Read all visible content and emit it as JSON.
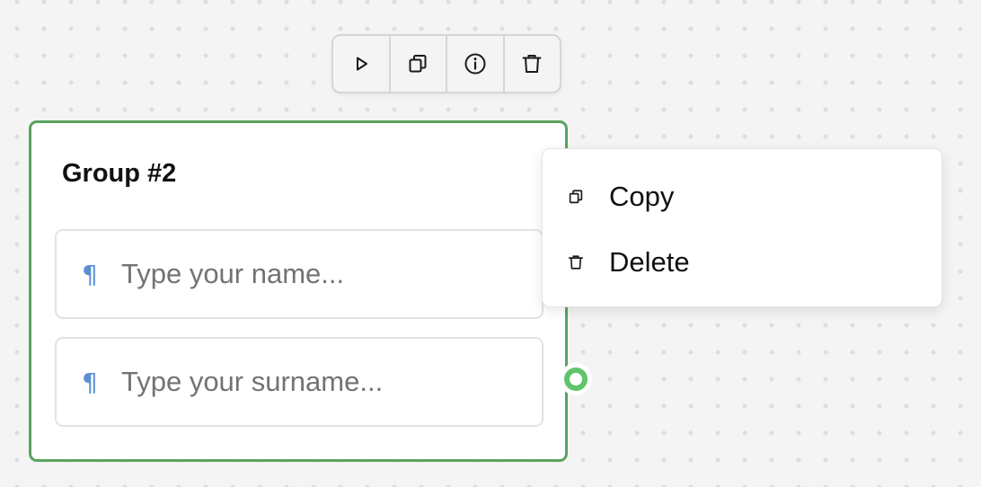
{
  "toolbar": {
    "buttons": [
      {
        "icon": "play-icon",
        "name": "run-button"
      },
      {
        "icon": "copy-icon",
        "name": "duplicate-button"
      },
      {
        "icon": "info-icon",
        "name": "info-button"
      },
      {
        "icon": "trash-icon",
        "name": "delete-button"
      }
    ]
  },
  "group": {
    "title": "Group #2",
    "fields": [
      {
        "icon": "¶",
        "placeholder": "Type your name..."
      },
      {
        "icon": "¶",
        "placeholder": "Type your surname..."
      }
    ]
  },
  "context_menu": {
    "items": [
      {
        "label": "Copy",
        "icon": "copy-icon"
      },
      {
        "label": "Delete",
        "icon": "trash-icon"
      }
    ]
  },
  "colors": {
    "group_border": "#5aa35e",
    "connector": "#5fc46a",
    "paragraph_icon": "#5b8fd4",
    "canvas": "#f4f4f4"
  }
}
